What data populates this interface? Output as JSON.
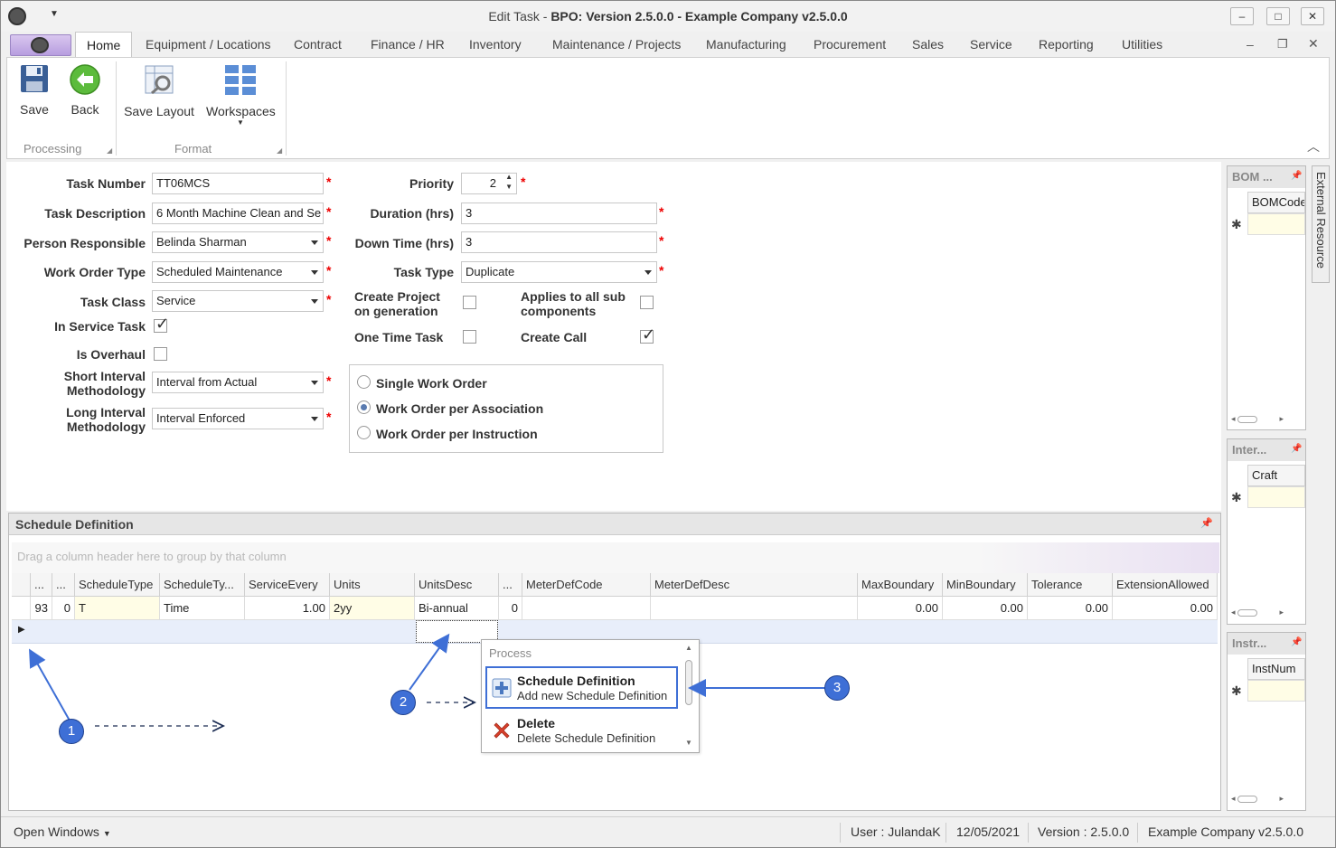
{
  "window": {
    "title_prefix": "Edit Task",
    "title_main": "BPO: Version 2.5.0.0 - Example Company v2.5.0.0",
    "min_glyph": "–",
    "max_glyph": "□",
    "close_glyph": "✕"
  },
  "ribbon_tabs": [
    "Home",
    "Equipment / Locations",
    "Contract",
    "Finance / HR",
    "Inventory",
    "Maintenance / Projects",
    "Manufacturing",
    "Procurement",
    "Sales",
    "Service",
    "Reporting",
    "Utilities"
  ],
  "ribbon": {
    "save": "Save",
    "back": "Back",
    "save_layout": "Save Layout",
    "workspaces": "Workspaces",
    "group_processing": "Processing",
    "group_format": "Format"
  },
  "form": {
    "task_number_label": "Task Number",
    "task_number": "TT06MCS",
    "task_description_label": "Task Description",
    "task_description": "6 Month Machine Clean and Se",
    "person_responsible_label": "Person Responsible",
    "person_responsible": "Belinda Sharman",
    "work_order_type_label": "Work Order Type",
    "work_order_type": "Scheduled Maintenance",
    "task_class_label": "Task Class",
    "task_class": "Service",
    "in_service_task_label": "In Service Task",
    "in_service_task": true,
    "is_overhaul_label": "Is Overhaul",
    "is_overhaul": false,
    "short_interval_label_1": "Short Interval",
    "short_interval_label_2": "Methodology",
    "short_interval": "Interval from Actual",
    "long_interval_label_1": "Long Interval",
    "long_interval_label_2": "Methodology",
    "long_interval": "Interval Enforced",
    "priority_label": "Priority",
    "priority": "2",
    "duration_label": "Duration (hrs)",
    "duration": "3",
    "down_time_label": "Down Time (hrs)",
    "down_time": "3",
    "task_type_label": "Task Type",
    "task_type": "Duplicate",
    "create_project_label_1": "Create Project",
    "create_project_label_2": "on generation",
    "applies_label_1": "Applies to all sub",
    "applies_label_2": "components",
    "one_time_task_label": "One Time Task",
    "create_call_label": "Create Call",
    "required_mark": "*",
    "wo_options": [
      "Single Work Order",
      "Work Order per Association",
      "Work Order per Instruction"
    ],
    "wo_selected": "Work Order per Association"
  },
  "schedule": {
    "title": "Schedule Definition",
    "group_hint": "Drag a column header here to group by that column",
    "columns": [
      "...",
      "...",
      "ScheduleType",
      "ScheduleTy...",
      "ServiceEvery",
      "Units",
      "UnitsDesc",
      "...",
      "MeterDefCode",
      "MeterDefDesc",
      "MaxBoundary",
      "MinBoundary",
      "Tolerance",
      "ExtensionAllowed"
    ],
    "row": [
      "93",
      "0",
      "T",
      "Time",
      "1.00",
      "2yy",
      "Bi-annual",
      "0",
      "",
      "",
      "0.00",
      "0.00",
      "0.00",
      "0.00"
    ]
  },
  "context_menu": {
    "section": "Process",
    "items": [
      {
        "title": "Schedule Definition",
        "desc": "Add new Schedule Definition"
      },
      {
        "title": "Delete",
        "desc": "Delete Schedule Definition"
      }
    ]
  },
  "side_panels": [
    {
      "title": "BOM ...",
      "column": "BOMCode"
    },
    {
      "title": "Inter...",
      "column": "Craft"
    },
    {
      "title": "Instr...",
      "column": "InstNum"
    }
  ],
  "external_tab": "External Resource",
  "status": {
    "open_windows": "Open Windows",
    "user": "User : JulandaK",
    "date": "12/05/2021",
    "version": "Version : 2.5.0.0",
    "company": "Example Company v2.5.0.0"
  },
  "callouts": [
    "1",
    "2",
    "3"
  ],
  "colors": {
    "accent": "#3e6fd6",
    "required": "#e00000",
    "highlight_row": "#e8eefa",
    "edit_cell": "#fffde6"
  }
}
